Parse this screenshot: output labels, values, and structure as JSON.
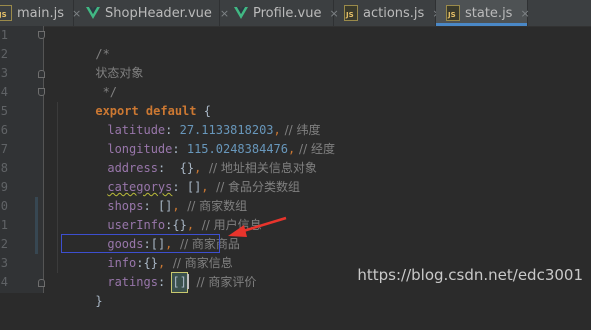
{
  "tabs": [
    {
      "label": "main.js",
      "type": "js",
      "active": false
    },
    {
      "label": "ShopHeader.vue",
      "type": "vue",
      "active": false
    },
    {
      "label": "Profile.vue",
      "type": "vue",
      "active": false
    },
    {
      "label": "actions.js",
      "type": "js",
      "active": false
    },
    {
      "label": "state.js",
      "type": "js",
      "active": true
    }
  ],
  "icons": {
    "js_badge": "JS",
    "close": "×"
  },
  "colors": {
    "vue_icon": "#41b883",
    "annotation_box": "#3d4fd0",
    "annotation_arrow": "#e8342c"
  },
  "gutter": {
    "line_numbers": [
      "1",
      "2",
      "3",
      "4",
      "5",
      "6",
      "7",
      "8",
      "9",
      "0",
      "1",
      "2",
      "3",
      "4"
    ]
  },
  "code": {
    "l1": {
      "text": "/*"
    },
    "l2": {
      "text": "状态对象"
    },
    "l3": {
      "text": " */"
    },
    "l4": {
      "kw": "export default",
      "brace": " {"
    },
    "l5": {
      "key": "latitude",
      "colon": ": ",
      "value": "27.1133818203",
      "comma": ",",
      "comment": " // 纬度"
    },
    "l6": {
      "key": "longitude",
      "colon": ": ",
      "value": "115.0248384476",
      "comma": ",",
      "comment": " // 经度"
    },
    "l7": {
      "key": "address",
      "colon": ":  ",
      "value": "{}",
      "comma": ",",
      "comment": "  // 地址相关信息对象"
    },
    "l8": {
      "key": "categorys",
      "colon": ": ",
      "value": "[]",
      "comma": ",",
      "comment": "  // 食品分类数组"
    },
    "l9": {
      "key": "shops",
      "colon": ": ",
      "value": "[]",
      "comma": ",",
      "comment": "  // 商家数组"
    },
    "l10": {
      "key": "userInfo",
      "colon": ":",
      "value": "{}",
      "comma": ",",
      "comment": "  // 用户信息"
    },
    "l11": {
      "key": "goods",
      "colon": ":",
      "value": "[]",
      "comma": ",",
      "comment": "  // 商家商品"
    },
    "l12": {
      "key": "info",
      "colon": ":",
      "value": "{}",
      "comma": ",",
      "comment": "  // 商家信息"
    },
    "l13": {
      "key": "ratings",
      "colon": ": ",
      "value": "[]",
      "comment": "  // 商家评价"
    },
    "l14": {
      "text": "}"
    }
  },
  "watermark": "https://blog.csdn.net/edc3001"
}
